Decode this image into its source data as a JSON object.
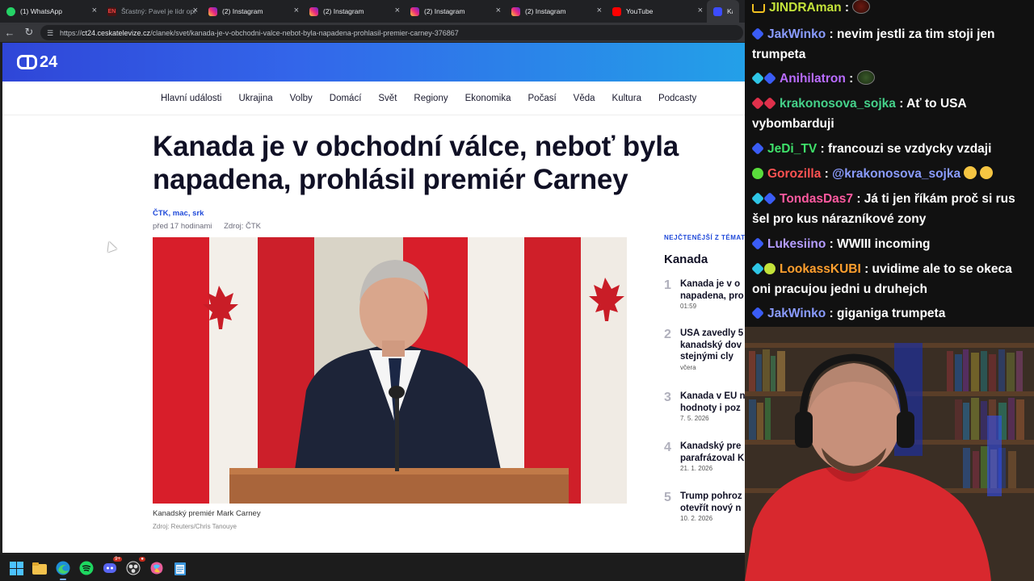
{
  "browser": {
    "tabs": [
      {
        "title": "(1) WhatsApp",
        "favicon": "whatsapp-icon"
      },
      {
        "title": "Šťastný: Pavel je lídr opo",
        "favicon": "en-icon"
      },
      {
        "title": "(2) Instagram",
        "favicon": "instagram-icon"
      },
      {
        "title": "(2) Instagram",
        "favicon": "instagram-icon"
      },
      {
        "title": "(2) Instagram",
        "favicon": "instagram-icon"
      },
      {
        "title": "(2) Instagram",
        "favicon": "instagram-icon"
      },
      {
        "title": "YouTube",
        "favicon": "youtube-icon"
      },
      {
        "title": "Kana",
        "favicon": "ct24-icon"
      }
    ],
    "url_prefix": "https://",
    "url_host": "ct24.ceskatelevize.cz",
    "url_path": "/clanek/svet/kanada-je-v-obchodni-valce-nebot-byla-napadena-prohlasil-premier-carney-376867"
  },
  "site": {
    "logo_text": "24",
    "nav": [
      "Hlavní události",
      "Ukrajina",
      "Volby",
      "Domácí",
      "Svět",
      "Regiony",
      "Ekonomika",
      "Počasí",
      "Věda",
      "Kultura",
      "Podcasty"
    ]
  },
  "article": {
    "headline": "Kanada je v obchodní válce, neboť byla napadena, prohlásil premiér Carney",
    "authors": "ČTK, mac, srk",
    "time": "před 17 hodinami",
    "source": "Zdroj: ČTK",
    "caption": "Kanadský premiér Mark Carney",
    "credit": "Zdroj: Reuters/Chris Tanouye"
  },
  "sidebar": {
    "kicker": "NEJČTENĚJŠÍ Z TÉMATU",
    "title": "Kanada",
    "items": [
      {
        "num": "1",
        "title": "Kanada je v o\nnapadena, pro",
        "date": "01:59"
      },
      {
        "num": "2",
        "title": "USA zavedly 5\nkanadský dov\nstejnými cly",
        "date": "včera"
      },
      {
        "num": "3",
        "title": "Kanada v EU n\nhodnoty i poz",
        "date": "7. 5. 2026"
      },
      {
        "num": "4",
        "title": "Kanadský pre\nparafrázoval K",
        "date": "21. 1. 2026"
      },
      {
        "num": "5",
        "title": "Trump pohroz\notevřít nový n",
        "date": "10. 2. 2026"
      }
    ]
  },
  "chat": [
    {
      "user": "JINDRAman",
      "color": "#c3e23a",
      "badges": [
        "crown"
      ],
      "text": " : ",
      "emote": true
    },
    {
      "user": "JakWinko",
      "color": "#8a9cff",
      "badges": [
        "blue"
      ],
      "text": " : nevim jestli za tim stoji jen trumpeta"
    },
    {
      "user": "Anihilatron",
      "color": "#b96cff",
      "badges": [
        "cyan",
        "blue"
      ],
      "text": " : ",
      "emote": true
    },
    {
      "user": "krakonosova_sojka",
      "color": "#45d28a",
      "badges": [
        "red",
        "red"
      ],
      "text": " : Ať to USA vybombarduji"
    },
    {
      "user": "JeDi_TV",
      "color": "#3fe06a",
      "badges": [
        "blue"
      ],
      "text": " : francouzi se vzdycky vzdaji"
    },
    {
      "user": "Gorozilla",
      "color": "#ff5252",
      "badges": [
        "green"
      ],
      "text": " : ",
      "mention": "@krakonosova_sojka",
      "grins": 2
    },
    {
      "user": "TondasDas7",
      "color": "#ff5aa0",
      "badges": [
        "cyan",
        "blue"
      ],
      "text": " : Já ti jen říkám proč si rus šel pro kus nárazníkové zony"
    },
    {
      "user": "Lukesiino",
      "color": "#b49cff",
      "badges": [
        "blue"
      ],
      "text": " : WWIII incoming"
    },
    {
      "user": "LookassKUBI",
      "color": "#ff9f2e",
      "badges": [
        "cyan",
        "lime"
      ],
      "text": " : uvidime ale to se okeca oni pracujou jedni u druhejch"
    },
    {
      "user": "JakWinko",
      "color": "#8a9cff",
      "badges": [
        "blue"
      ],
      "text": " : giganiga trumpeta"
    }
  ]
}
